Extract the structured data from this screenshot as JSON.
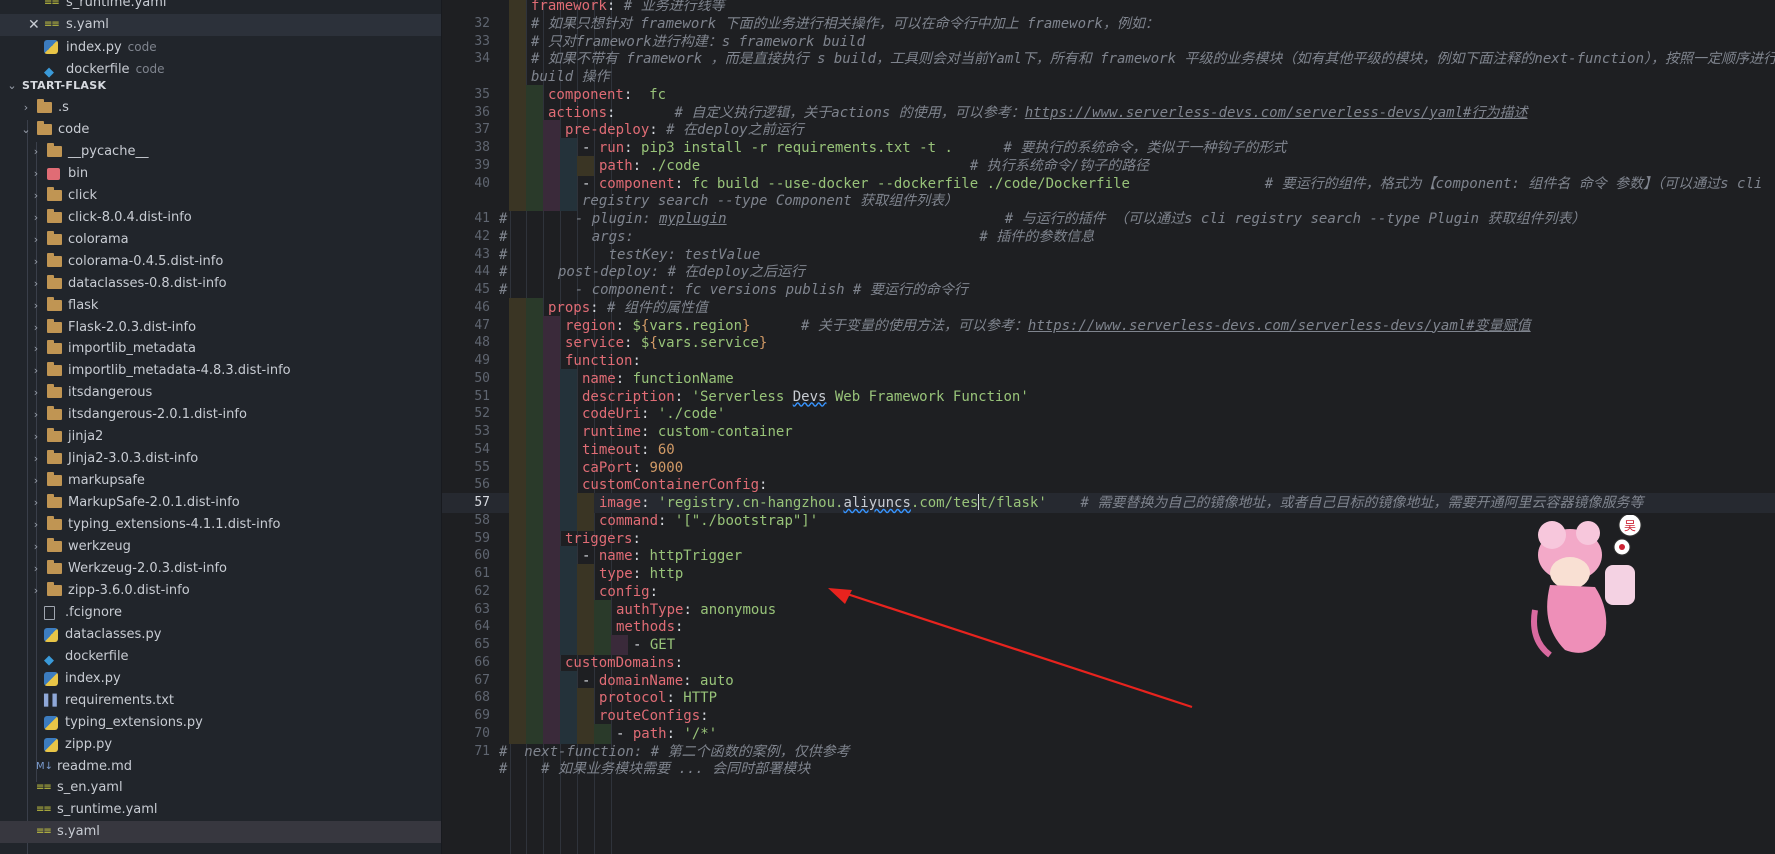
{
  "sidebar": {
    "open_editors": [
      {
        "label": "s_runtime.yaml",
        "type": "yaml"
      },
      {
        "label": "s.yaml",
        "type": "yaml",
        "active": true
      },
      {
        "label": "index.py",
        "desc": "code",
        "type": "py"
      },
      {
        "label": "dockerfile",
        "desc": "code",
        "type": "docker"
      }
    ],
    "project_title": "START-FLASK",
    "tree": [
      {
        "label": ".s",
        "type": "folder",
        "depth": 1,
        "chevron": "right"
      },
      {
        "label": "code",
        "type": "folder",
        "depth": 1,
        "chevron": "down"
      },
      {
        "label": "__pycache__",
        "type": "folder",
        "depth": 2,
        "chevron": "right"
      },
      {
        "label": "bin",
        "type": "bin",
        "depth": 2,
        "chevron": "right"
      },
      {
        "label": "click",
        "type": "folder",
        "depth": 2,
        "chevron": "right"
      },
      {
        "label": "click-8.0.4.dist-info",
        "type": "folder",
        "depth": 2,
        "chevron": "right"
      },
      {
        "label": "colorama",
        "type": "folder",
        "depth": 2,
        "chevron": "right"
      },
      {
        "label": "colorama-0.4.5.dist-info",
        "type": "folder",
        "depth": 2,
        "chevron": "right"
      },
      {
        "label": "dataclasses-0.8.dist-info",
        "type": "folder",
        "depth": 2,
        "chevron": "right"
      },
      {
        "label": "flask",
        "type": "folder",
        "depth": 2,
        "chevron": "right"
      },
      {
        "label": "Flask-2.0.3.dist-info",
        "type": "folder",
        "depth": 2,
        "chevron": "right"
      },
      {
        "label": "importlib_metadata",
        "type": "folder",
        "depth": 2,
        "chevron": "right"
      },
      {
        "label": "importlib_metadata-4.8.3.dist-info",
        "type": "folder",
        "depth": 2,
        "chevron": "right"
      },
      {
        "label": "itsdangerous",
        "type": "folder",
        "depth": 2,
        "chevron": "right"
      },
      {
        "label": "itsdangerous-2.0.1.dist-info",
        "type": "folder",
        "depth": 2,
        "chevron": "right"
      },
      {
        "label": "jinja2",
        "type": "folder",
        "depth": 2,
        "chevron": "right"
      },
      {
        "label": "Jinja2-3.0.3.dist-info",
        "type": "folder",
        "depth": 2,
        "chevron": "right"
      },
      {
        "label": "markupsafe",
        "type": "folder",
        "depth": 2,
        "chevron": "right"
      },
      {
        "label": "MarkupSafe-2.0.1.dist-info",
        "type": "folder",
        "depth": 2,
        "chevron": "right"
      },
      {
        "label": "typing_extensions-4.1.1.dist-info",
        "type": "folder",
        "depth": 2,
        "chevron": "right"
      },
      {
        "label": "werkzeug",
        "type": "folder",
        "depth": 2,
        "chevron": "right"
      },
      {
        "label": "Werkzeug-2.0.3.dist-info",
        "type": "folder",
        "depth": 2,
        "chevron": "right"
      },
      {
        "label": "zipp-3.6.0.dist-info",
        "type": "folder",
        "depth": 2,
        "chevron": "right"
      },
      {
        "label": ".fcignore",
        "type": "file",
        "depth": 2
      },
      {
        "label": "dataclasses.py",
        "type": "py",
        "depth": 2
      },
      {
        "label": "dockerfile",
        "type": "docker",
        "depth": 2
      },
      {
        "label": "index.py",
        "type": "py",
        "depth": 2
      },
      {
        "label": "requirements.txt",
        "type": "txt",
        "depth": 2
      },
      {
        "label": "typing_extensions.py",
        "type": "py",
        "depth": 2
      },
      {
        "label": "zipp.py",
        "type": "py",
        "depth": 2
      },
      {
        "label": "readme.md",
        "type": "md",
        "depth": 1
      },
      {
        "label": "s_en.yaml",
        "type": "yaml",
        "depth": 1
      },
      {
        "label": "s_runtime.yaml",
        "type": "yaml",
        "depth": 1
      },
      {
        "label": "s.yaml",
        "type": "yaml",
        "depth": 1,
        "selected": true
      }
    ]
  },
  "editor": {
    "active_line": "57",
    "lines": [
      {
        "n": "",
        "indent": 1,
        "parts": [
          [
            "k",
            "framework"
          ],
          [
            "g",
            ":"
          ],
          [
            "c",
            " # 业务进行线等"
          ]
        ]
      },
      {
        "n": "32",
        "indent": 1,
        "parts": [
          [
            "c",
            "# 如果只想针对 framework 下面的业务进行相关操作，可以在命令行中加上 framework，例如："
          ]
        ]
      },
      {
        "n": "33",
        "indent": 1,
        "parts": [
          [
            "c",
            "# 只对framework进行构建：s framework build"
          ]
        ]
      },
      {
        "n": "34",
        "indent": 1,
        "parts": [
          [
            "c",
            "# 如果不带有 framework ，而是直接执行 s build，工具则会对当前Yaml下，所有和 framework 平级的业务模块（如有其他平级的模块，例如下面注释的next-function），按照一定顺序进行"
          ]
        ]
      },
      {
        "n": "",
        "indent": 1,
        "parts": [
          [
            "c",
            "build 操作"
          ]
        ]
      },
      {
        "n": "35",
        "indent": 2,
        "parts": [
          [
            "k",
            "component"
          ],
          [
            "g",
            ":  "
          ],
          [
            "s",
            "fc"
          ]
        ]
      },
      {
        "n": "36",
        "indent": 2,
        "parts": [
          [
            "k",
            "actions"
          ],
          [
            "g",
            ":       "
          ],
          [
            "c",
            "# 自定义执行逻辑，关于actions 的使用，可以参考："
          ],
          [
            "l",
            "https://www.serverless-devs.com/serverless-devs/yaml#行为描述"
          ]
        ]
      },
      {
        "n": "37",
        "indent": 3,
        "parts": [
          [
            "k",
            "pre-deploy"
          ],
          [
            "g",
            ": "
          ],
          [
            "c",
            "# 在deploy之前运行"
          ]
        ]
      },
      {
        "n": "38",
        "indent": 4,
        "parts": [
          [
            "g",
            "- "
          ],
          [
            "k",
            "run"
          ],
          [
            "g",
            ": "
          ],
          [
            "s",
            "pip3 install -r requirements.txt -t ."
          ],
          [
            "g",
            "      "
          ],
          [
            "c",
            "# 要执行的系统命令，类似于一种钩子的形式"
          ]
        ]
      },
      {
        "n": "39",
        "indent": 5,
        "parts": [
          [
            "k",
            "path"
          ],
          [
            "g",
            ": "
          ],
          [
            "s",
            "./code"
          ],
          [
            "g",
            "                                "
          ],
          [
            "c",
            "# 执行系统命令/钩子的路径"
          ]
        ]
      },
      {
        "n": "40",
        "indent": 4,
        "parts": [
          [
            "g",
            "- "
          ],
          [
            "k",
            "component"
          ],
          [
            "g",
            ": "
          ],
          [
            "s",
            "fc build --use-docker --dockerfile ./code/Dockerfile"
          ],
          [
            "g",
            "                "
          ],
          [
            "c",
            "# 要运行的组件，格式为【component: 组件名 命令 参数】（可以通过s cli"
          ]
        ]
      },
      {
        "n": "",
        "indent": 4,
        "parts": [
          [
            "c",
            "registry search --type Component 获取组件列表）"
          ]
        ]
      },
      {
        "n": "41",
        "indent": 0,
        "parts": [
          [
            "c",
            "#        - plugin: "
          ],
          [
            "l",
            "myplugin"
          ],
          [
            "c",
            "                                 # 与运行的插件 （可以通过s cli registry search --type Plugin 获取组件列表）"
          ]
        ]
      },
      {
        "n": "42",
        "indent": 0,
        "parts": [
          [
            "c",
            "#          args:                                         # 插件的参数信息"
          ]
        ]
      },
      {
        "n": "43",
        "indent": 0,
        "parts": [
          [
            "c",
            "#            testKey: testValue"
          ]
        ]
      },
      {
        "n": "44",
        "indent": 0,
        "parts": [
          [
            "c",
            "#      post-deploy: # 在deploy之后运行"
          ]
        ]
      },
      {
        "n": "45",
        "indent": 0,
        "parts": [
          [
            "c",
            "#        - component: fc versions publish # 要运行的命令行"
          ]
        ]
      },
      {
        "n": "46",
        "indent": 2,
        "parts": [
          [
            "k",
            "props"
          ],
          [
            "g",
            ": "
          ],
          [
            "c",
            "# 组件的属性值"
          ]
        ]
      },
      {
        "n": "47",
        "indent": 3,
        "parts": [
          [
            "k",
            "region"
          ],
          [
            "g",
            ": "
          ],
          [
            "s",
            "$"
          ],
          [
            "v",
            "{"
          ],
          [
            "s",
            "vars.region"
          ],
          [
            "v",
            "}"
          ],
          [
            "g",
            "      "
          ],
          [
            "c",
            "# 关于变量的使用方法，可以参考："
          ],
          [
            "l",
            "https://www.serverless-devs.com/serverless-devs/yaml#变量赋值"
          ]
        ]
      },
      {
        "n": "48",
        "indent": 3,
        "parts": [
          [
            "k",
            "service"
          ],
          [
            "g",
            ": "
          ],
          [
            "s",
            "$"
          ],
          [
            "v",
            "{"
          ],
          [
            "s",
            "vars.service"
          ],
          [
            "v",
            "}"
          ]
        ]
      },
      {
        "n": "49",
        "indent": 3,
        "parts": [
          [
            "k",
            "function"
          ],
          [
            "g",
            ":"
          ]
        ]
      },
      {
        "n": "50",
        "indent": 4,
        "parts": [
          [
            "k",
            "name"
          ],
          [
            "g",
            ": "
          ],
          [
            "s",
            "functionName"
          ]
        ]
      },
      {
        "n": "51",
        "indent": 4,
        "parts": [
          [
            "k",
            "description"
          ],
          [
            "g",
            ": "
          ],
          [
            "s",
            "'Serverless "
          ],
          [
            "sq",
            "Devs"
          ],
          [
            "s",
            " Web Framework Function'"
          ]
        ]
      },
      {
        "n": "52",
        "indent": 4,
        "parts": [
          [
            "k",
            "codeUri"
          ],
          [
            "g",
            ": "
          ],
          [
            "s",
            "'./code'"
          ]
        ]
      },
      {
        "n": "53",
        "indent": 4,
        "parts": [
          [
            "k",
            "runtime"
          ],
          [
            "g",
            ": "
          ],
          [
            "s",
            "custom-container"
          ]
        ]
      },
      {
        "n": "54",
        "indent": 4,
        "parts": [
          [
            "k",
            "timeout"
          ],
          [
            "g",
            ": "
          ],
          [
            "v",
            "60"
          ]
        ]
      },
      {
        "n": "55",
        "indent": 4,
        "parts": [
          [
            "k",
            "caPort"
          ],
          [
            "g",
            ": "
          ],
          [
            "v",
            "9000"
          ]
        ]
      },
      {
        "n": "56",
        "indent": 4,
        "parts": [
          [
            "k",
            "customContainerConfig"
          ],
          [
            "g",
            ":"
          ]
        ]
      },
      {
        "n": "57",
        "indent": 5,
        "parts": [
          [
            "k",
            "image"
          ],
          [
            "g",
            ": "
          ],
          [
            "s",
            "'registry.cn-hangzhou."
          ],
          [
            "sq",
            "aliyuncs"
          ],
          [
            "s",
            ".com/tes"
          ],
          [
            "cursor",
            ""
          ],
          [
            "s",
            "t/flask'"
          ],
          [
            "g",
            "    "
          ],
          [
            "c",
            "# 需要替换为自己的镜像地址，或者自己目标的镜像地址，需要开通阿里云容器镜像服务等"
          ]
        ]
      },
      {
        "n": "58",
        "indent": 5,
        "parts": [
          [
            "k",
            "command"
          ],
          [
            "g",
            ": "
          ],
          [
            "s",
            "'[\"./bootstrap\"]'"
          ]
        ]
      },
      {
        "n": "59",
        "indent": 3,
        "parts": [
          [
            "k",
            "triggers"
          ],
          [
            "g",
            ":"
          ]
        ]
      },
      {
        "n": "60",
        "indent": 4,
        "parts": [
          [
            "g",
            "- "
          ],
          [
            "k",
            "name"
          ],
          [
            "g",
            ": "
          ],
          [
            "s",
            "httpTrigger"
          ]
        ]
      },
      {
        "n": "61",
        "indent": 5,
        "parts": [
          [
            "k",
            "type"
          ],
          [
            "g",
            ": "
          ],
          [
            "s",
            "http"
          ]
        ]
      },
      {
        "n": "62",
        "indent": 5,
        "parts": [
          [
            "k",
            "config"
          ],
          [
            "g",
            ":"
          ]
        ]
      },
      {
        "n": "63",
        "indent": 6,
        "parts": [
          [
            "k",
            "authType"
          ],
          [
            "g",
            ": "
          ],
          [
            "s",
            "anonymous"
          ]
        ]
      },
      {
        "n": "64",
        "indent": 6,
        "parts": [
          [
            "k",
            "methods"
          ],
          [
            "g",
            ":"
          ]
        ]
      },
      {
        "n": "65",
        "indent": 7,
        "parts": [
          [
            "g",
            "- "
          ],
          [
            "s",
            "GET"
          ]
        ]
      },
      {
        "n": "66",
        "indent": 3,
        "parts": [
          [
            "k",
            "customDomains"
          ],
          [
            "g",
            ":"
          ]
        ]
      },
      {
        "n": "67",
        "indent": 4,
        "parts": [
          [
            "g",
            "- "
          ],
          [
            "k",
            "domainName"
          ],
          [
            "g",
            ": "
          ],
          [
            "s",
            "auto"
          ]
        ]
      },
      {
        "n": "68",
        "indent": 5,
        "parts": [
          [
            "k",
            "protocol"
          ],
          [
            "g",
            ": "
          ],
          [
            "s",
            "HTTP"
          ]
        ]
      },
      {
        "n": "69",
        "indent": 5,
        "parts": [
          [
            "k",
            "routeConfigs"
          ],
          [
            "g",
            ":"
          ]
        ]
      },
      {
        "n": "70",
        "indent": 6,
        "parts": [
          [
            "g",
            "- "
          ],
          [
            "k",
            "path"
          ],
          [
            "g",
            ": "
          ],
          [
            "s",
            "'/*'"
          ]
        ]
      },
      {
        "n": "71",
        "indent": 0,
        "parts": [
          [
            "c",
            "#  next-function: # 第二个函数的案例，仅供参考"
          ]
        ]
      },
      {
        "n": "",
        "indent": 0,
        "parts": [
          [
            "c",
            "#    # 如果业务模块需要 ... 会同时部署模块"
          ]
        ]
      }
    ]
  },
  "overlay": {
    "arrow_color": "#e8231e",
    "sticker_label": "吴"
  }
}
